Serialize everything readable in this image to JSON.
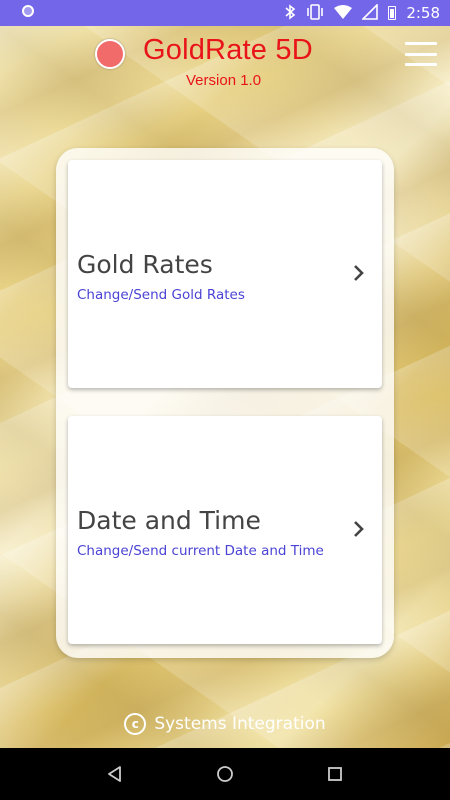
{
  "status_bar": {
    "time": "2:58",
    "icons": [
      "bluetooth-icon",
      "vibrate-icon",
      "wifi-icon",
      "signal-icon",
      "battery-icon"
    ]
  },
  "header": {
    "title": "GoldRate 5D",
    "version": "Version 1.0",
    "indicator_color": "#f26b6b",
    "title_color": "#e8141a"
  },
  "cards": [
    {
      "title": "Gold Rates",
      "subtitle": "Change/Send Gold Rates"
    },
    {
      "title": "Date and Time",
      "subtitle": "Change/Send current Date and Time"
    }
  ],
  "footer": {
    "text": "Systems Integration"
  },
  "nav": [
    "back-icon",
    "home-icon",
    "recents-icon"
  ]
}
